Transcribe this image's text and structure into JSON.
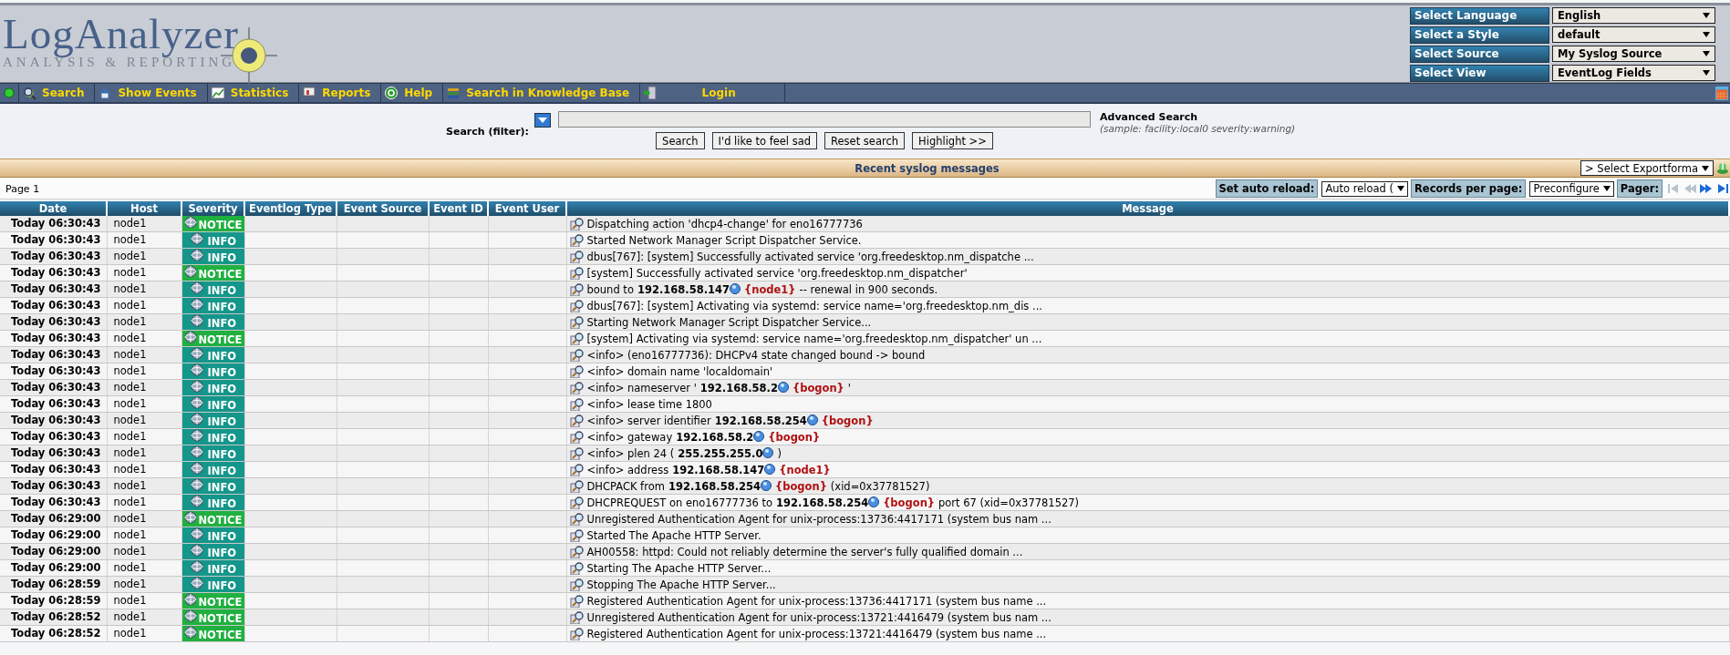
{
  "header": {
    "logo_title": "LogAnalyzer",
    "logo_subtitle": "ANALYSIS & REPORTING",
    "selectors": [
      {
        "label": "Select Language",
        "value": "English"
      },
      {
        "label": "Select a Style",
        "value": "default"
      },
      {
        "label": "Select Source",
        "value": "My Syslog Source"
      },
      {
        "label": "Select View",
        "value": "EventLog Fields"
      }
    ]
  },
  "nav": {
    "items": [
      {
        "label": "Search"
      },
      {
        "label": "Show Events"
      },
      {
        "label": "Statistics"
      },
      {
        "label": "Reports"
      },
      {
        "label": "Help"
      },
      {
        "label": "Search in Knowledge Base"
      },
      {
        "label": "Login"
      }
    ]
  },
  "search": {
    "label": "Search (filter):",
    "advanced_title": "Advanced Search",
    "advanced_sample": "(sample: facility:local0 severity:warning)",
    "buttons": [
      "Search",
      "I'd like to feel sad",
      "Reset search",
      "Highlight >>"
    ]
  },
  "section_title": "Recent syslog messages",
  "export_select": "> Select Exportforma",
  "pagebar": {
    "page": "Page 1",
    "auto_reload_label": "Set auto reload:",
    "auto_reload_value": "Auto reload (",
    "records_label": "Records per page:",
    "records_value": "Preconfigure",
    "pager_label": "Pager:",
    "pager": [
      {
        "kind": "first",
        "disabled": true
      },
      {
        "kind": "prev",
        "disabled": true
      },
      {
        "kind": "next",
        "disabled": false
      },
      {
        "kind": "last",
        "disabled": false
      }
    ]
  },
  "table": {
    "columns": [
      "Date",
      "Host",
      "Severity",
      "Eventlog Type",
      "Event Source",
      "Event ID",
      "Event User",
      "Message"
    ],
    "rows": [
      {
        "date": "Today 06:30:43",
        "host": "node1",
        "severity": {
          "label": "NOTICE",
          "color": "#20b040"
        },
        "message": [
          {
            "kind": "text",
            "text": "Dispatching action 'dhcp4-change' for eno16777736"
          }
        ]
      },
      {
        "date": "Today 06:30:43",
        "host": "node1",
        "severity": {
          "label": "INFO",
          "color": "#15968a"
        },
        "message": [
          {
            "kind": "text",
            "text": "Started Network Manager Script Dispatcher Service."
          }
        ]
      },
      {
        "date": "Today 06:30:43",
        "host": "node1",
        "severity": {
          "label": "INFO",
          "color": "#15968a"
        },
        "message": [
          {
            "kind": "text",
            "text": "dbus[767]: [system] Successfully activated service 'org.freedesktop.nm_dispatche ..."
          }
        ]
      },
      {
        "date": "Today 06:30:43",
        "host": "node1",
        "severity": {
          "label": "NOTICE",
          "color": "#20b040"
        },
        "message": [
          {
            "kind": "text",
            "text": "[system] Successfully activated service 'org.freedesktop.nm_dispatcher'"
          }
        ]
      },
      {
        "date": "Today 06:30:43",
        "host": "node1",
        "severity": {
          "label": "INFO",
          "color": "#15968a"
        },
        "message": [
          {
            "kind": "text",
            "text": "bound to"
          },
          {
            "kind": "ip",
            "text": "192.168.58.147"
          },
          {
            "kind": "tag",
            "text": "{node1}"
          },
          {
            "kind": "text",
            "text": "-- renewal in 900 seconds."
          }
        ]
      },
      {
        "date": "Today 06:30:43",
        "host": "node1",
        "severity": {
          "label": "INFO",
          "color": "#15968a"
        },
        "message": [
          {
            "kind": "text",
            "text": "dbus[767]: [system] Activating via systemd: service name='org.freedesktop.nm_dis ..."
          }
        ]
      },
      {
        "date": "Today 06:30:43",
        "host": "node1",
        "severity": {
          "label": "INFO",
          "color": "#15968a"
        },
        "message": [
          {
            "kind": "text",
            "text": "Starting Network Manager Script Dispatcher Service..."
          }
        ]
      },
      {
        "date": "Today 06:30:43",
        "host": "node1",
        "severity": {
          "label": "NOTICE",
          "color": "#20b040"
        },
        "message": [
          {
            "kind": "text",
            "text": "[system] Activating via systemd: service name='org.freedesktop.nm_dispatcher' un ..."
          }
        ]
      },
      {
        "date": "Today 06:30:43",
        "host": "node1",
        "severity": {
          "label": "INFO",
          "color": "#15968a"
        },
        "message": [
          {
            "kind": "text",
            "text": "<info> (eno16777736): DHCPv4 state changed bound -> bound"
          }
        ]
      },
      {
        "date": "Today 06:30:43",
        "host": "node1",
        "severity": {
          "label": "INFO",
          "color": "#15968a"
        },
        "message": [
          {
            "kind": "text",
            "text": "<info> domain name 'localdomain'"
          }
        ]
      },
      {
        "date": "Today 06:30:43",
        "host": "node1",
        "severity": {
          "label": "INFO",
          "color": "#15968a"
        },
        "message": [
          {
            "kind": "text",
            "text": "<info> nameserver '"
          },
          {
            "kind": "ip",
            "text": "192.168.58.2"
          },
          {
            "kind": "tag",
            "text": "{bogon}"
          },
          {
            "kind": "text",
            "text": "'"
          }
        ]
      },
      {
        "date": "Today 06:30:43",
        "host": "node1",
        "severity": {
          "label": "INFO",
          "color": "#15968a"
        },
        "message": [
          {
            "kind": "text",
            "text": "<info> lease time 1800"
          }
        ]
      },
      {
        "date": "Today 06:30:43",
        "host": "node1",
        "severity": {
          "label": "INFO",
          "color": "#15968a"
        },
        "message": [
          {
            "kind": "text",
            "text": "<info> server identifier"
          },
          {
            "kind": "ip",
            "text": "192.168.58.254"
          },
          {
            "kind": "tag",
            "text": "{bogon}"
          }
        ]
      },
      {
        "date": "Today 06:30:43",
        "host": "node1",
        "severity": {
          "label": "INFO",
          "color": "#15968a"
        },
        "message": [
          {
            "kind": "text",
            "text": "<info> gateway"
          },
          {
            "kind": "ip",
            "text": "192.168.58.2"
          },
          {
            "kind": "tag",
            "text": "{bogon}"
          }
        ]
      },
      {
        "date": "Today 06:30:43",
        "host": "node1",
        "severity": {
          "label": "INFO",
          "color": "#15968a"
        },
        "message": [
          {
            "kind": "text",
            "text": "<info> plen 24 ("
          },
          {
            "kind": "ip",
            "text": "255.255.255.0"
          },
          {
            "kind": "text",
            "text": ")"
          }
        ]
      },
      {
        "date": "Today 06:30:43",
        "host": "node1",
        "severity": {
          "label": "INFO",
          "color": "#15968a"
        },
        "message": [
          {
            "kind": "text",
            "text": "<info> address"
          },
          {
            "kind": "ip",
            "text": "192.168.58.147"
          },
          {
            "kind": "tag",
            "text": "{node1}"
          }
        ]
      },
      {
        "date": "Today 06:30:43",
        "host": "node1",
        "severity": {
          "label": "INFO",
          "color": "#15968a"
        },
        "message": [
          {
            "kind": "text",
            "text": "DHCPACK from"
          },
          {
            "kind": "ip",
            "text": "192.168.58.254"
          },
          {
            "kind": "tag",
            "text": "{bogon}"
          },
          {
            "kind": "text",
            "text": "(xid=0x37781527)"
          }
        ]
      },
      {
        "date": "Today 06:30:43",
        "host": "node1",
        "severity": {
          "label": "INFO",
          "color": "#15968a"
        },
        "message": [
          {
            "kind": "text",
            "text": "DHCPREQUEST on eno16777736 to"
          },
          {
            "kind": "ip",
            "text": "192.168.58.254"
          },
          {
            "kind": "tag",
            "text": "{bogon}"
          },
          {
            "kind": "text",
            "text": "port 67 (xid=0x37781527)"
          }
        ]
      },
      {
        "date": "Today 06:29:00",
        "host": "node1",
        "severity": {
          "label": "NOTICE",
          "color": "#20b040"
        },
        "message": [
          {
            "kind": "text",
            "text": "Unregistered Authentication Agent for unix-process:13736:4417171 (system bus nam ..."
          }
        ]
      },
      {
        "date": "Today 06:29:00",
        "host": "node1",
        "severity": {
          "label": "INFO",
          "color": "#15968a"
        },
        "message": [
          {
            "kind": "text",
            "text": "Started The Apache HTTP Server."
          }
        ]
      },
      {
        "date": "Today 06:29:00",
        "host": "node1",
        "severity": {
          "label": "INFO",
          "color": "#15968a"
        },
        "message": [
          {
            "kind": "text",
            "text": "AH00558: httpd: Could not reliably determine the server's fully qualified domain ..."
          }
        ]
      },
      {
        "date": "Today 06:29:00",
        "host": "node1",
        "severity": {
          "label": "INFO",
          "color": "#15968a"
        },
        "message": [
          {
            "kind": "text",
            "text": "Starting The Apache HTTP Server..."
          }
        ]
      },
      {
        "date": "Today 06:28:59",
        "host": "node1",
        "severity": {
          "label": "INFO",
          "color": "#15968a"
        },
        "message": [
          {
            "kind": "text",
            "text": "Stopping The Apache HTTP Server..."
          }
        ]
      },
      {
        "date": "Today 06:28:59",
        "host": "node1",
        "severity": {
          "label": "NOTICE",
          "color": "#20b040"
        },
        "message": [
          {
            "kind": "text",
            "text": "Registered Authentication Agent for unix-process:13736:4417171 (system bus name ..."
          }
        ]
      },
      {
        "date": "Today 06:28:52",
        "host": "node1",
        "severity": {
          "label": "NOTICE",
          "color": "#20b040"
        },
        "message": [
          {
            "kind": "text",
            "text": "Unregistered Authentication Agent for unix-process:13721:4416479 (system bus nam ..."
          }
        ]
      },
      {
        "date": "Today 06:28:52",
        "host": "node1",
        "severity": {
          "label": "NOTICE",
          "color": "#20b040"
        },
        "message": [
          {
            "kind": "text",
            "text": "Registered Authentication Agent for unix-process:13721:4416479 (system bus name ..."
          }
        ]
      }
    ]
  }
}
